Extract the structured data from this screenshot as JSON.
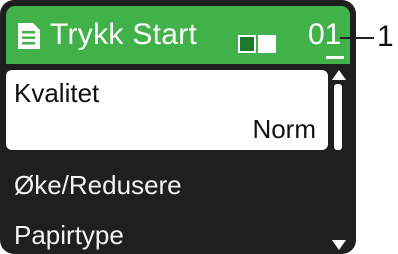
{
  "header": {
    "title": "Trykk Start",
    "icon": "document-icon",
    "copies": "01"
  },
  "callout": {
    "label": "1"
  },
  "menu": {
    "items": [
      {
        "label": "Kvalitet",
        "value": "Norm",
        "selected": true
      },
      {
        "label": "Øke/Redusere"
      },
      {
        "label": "Papirtype"
      }
    ]
  },
  "colors": {
    "header_bg": "#41b14a",
    "screen_bg": "#1f1f1f",
    "selected_bg": "#ffffff",
    "indicator_green": "#1c7a2a"
  }
}
